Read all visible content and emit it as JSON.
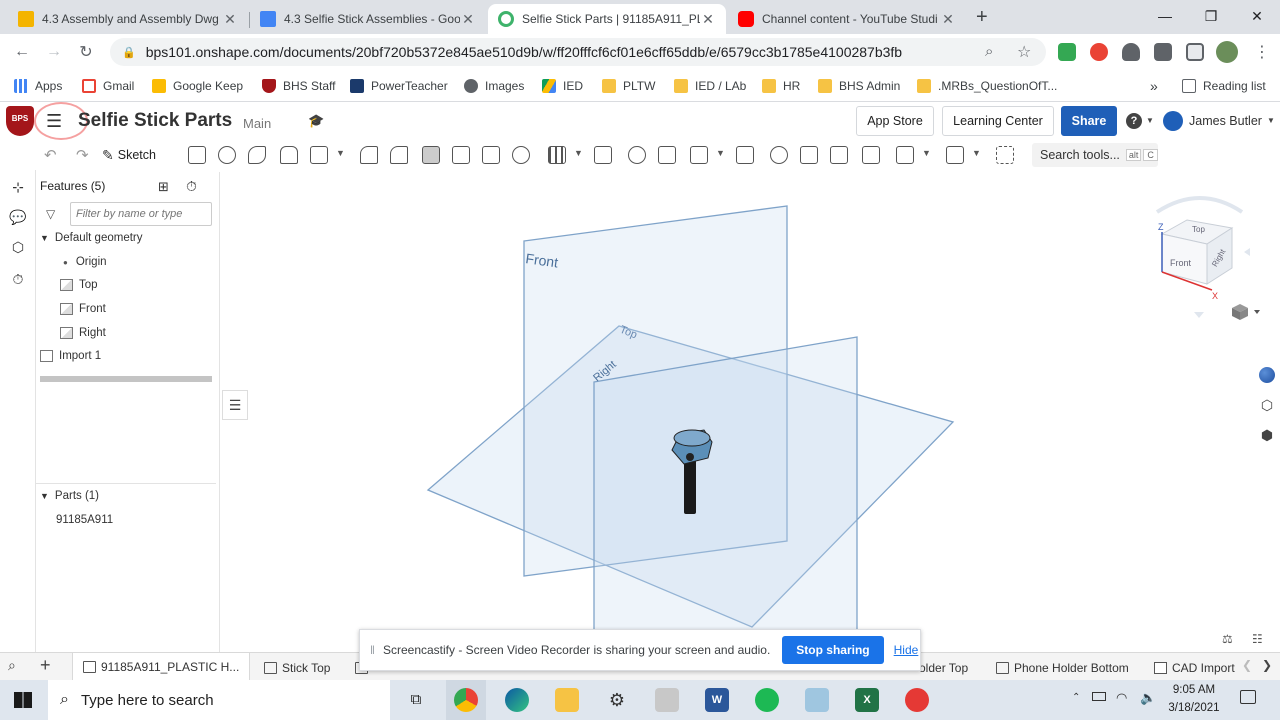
{
  "browser": {
    "tabs": [
      {
        "title": "4.3 Assembly and Assembly Dwg",
        "icon": "slides-icon",
        "color": "#f4b400"
      },
      {
        "title": "4.3 Selfie Stick Assemblies - Goo",
        "icon": "docs-icon",
        "color": "#4285f4"
      },
      {
        "title": "Selfie Stick Parts | 91185A911_PL",
        "icon": "onshape-icon",
        "color": "#3eb36b"
      },
      {
        "title": "Channel content - YouTube Studi",
        "icon": "youtube-icon",
        "color": "#ff0000"
      }
    ],
    "new_tab": "+",
    "url": "bps101.onshape.com/documents/20bf720b5372e845ae510d9b/w/ff20fffcf6cf01e6cff65ddb/e/6579cc3b1785e4100287b3fb",
    "bookmarks": [
      {
        "label": "Apps",
        "icon": "apps-grid-icon"
      },
      {
        "label": "Gmail",
        "icon": "gmail-icon"
      },
      {
        "label": "Google Keep",
        "icon": "keep-icon"
      },
      {
        "label": "BHS Staff",
        "icon": "bhs-shield-icon"
      },
      {
        "label": "PowerTeacher",
        "icon": "sis-icon"
      },
      {
        "label": "Images",
        "icon": "globe-icon"
      },
      {
        "label": "IED",
        "icon": "drive-icon"
      },
      {
        "label": "PLTW",
        "icon": "folder-icon"
      },
      {
        "label": "IED / LAb",
        "icon": "folder-icon"
      },
      {
        "label": "HR",
        "icon": "folder-icon"
      },
      {
        "label": "BHS Admin",
        "icon": "folder-icon"
      },
      {
        "label": ".MRBs_QuestionOfT...",
        "icon": "folder-icon"
      }
    ],
    "more": "»",
    "reading_list": "Reading list"
  },
  "onshape": {
    "logo_text": "BPS",
    "doc_title": "Selfie Stick Parts",
    "branch": "Main",
    "app_store": "App Store",
    "learning_center": "Learning Center",
    "share": "Share",
    "help": "?",
    "user": "James Butler",
    "sketch": "Sketch",
    "search_tools": "Search tools...",
    "shortcut_alt": "alt",
    "shortcut_c": "C"
  },
  "features": {
    "header": "Features (5)",
    "filter_placeholder": "Filter by name or type",
    "default_geometry": "Default geometry",
    "origin": "Origin",
    "top": "Top",
    "front": "Front",
    "right": "Right",
    "import": "Import 1",
    "parts_header": "Parts (1)",
    "part": "91185A911"
  },
  "viewport": {
    "plane_front": "Front",
    "plane_top": "Top",
    "plane_right": "Right",
    "cube_top": "Top",
    "cube_front": "Front",
    "cube_right": "Right",
    "axis_z": "Z",
    "axis_x": "X"
  },
  "bottom_tabs": [
    "91185A911_PLASTIC H...",
    "Stick Top",
    "older Top",
    "Phone Holder Bottom",
    "CAD Import"
  ],
  "sharebar": {
    "message": "Screencastify - Screen Video Recorder is sharing your screen and audio.",
    "stop": "Stop sharing",
    "hide": "Hide"
  },
  "taskbar": {
    "search": "Type here to search",
    "time": "9:05 AM",
    "date": "3/18/2021"
  },
  "colors": {
    "accent": "#1a73e8",
    "share_blue": "#1f5fb8",
    "plane_blue": "#7fa3c9"
  }
}
